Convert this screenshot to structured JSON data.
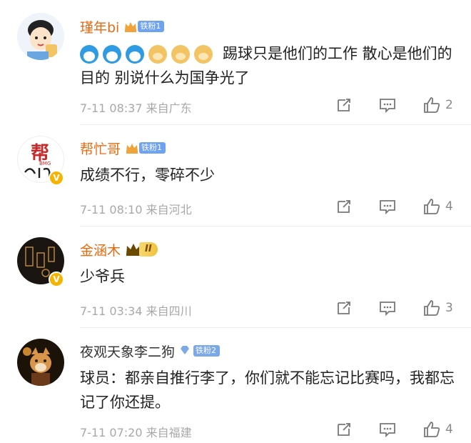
{
  "comments": [
    {
      "username": "瑾年bi",
      "fan_badge": "铁粉1",
      "text": "踢球只是他们的工作  散心是他们的目的 别说什么为国争光了",
      "emojis": [
        "doraemon",
        "doraemon",
        "doraemon",
        "doge",
        "doge",
        "doge"
      ],
      "meta": "7-11 08:37  来自广东",
      "likes": "2",
      "avatar_icon": "cartoon-avatar-icon"
    },
    {
      "username": "帮忙哥",
      "fan_badge": "铁粉1",
      "text": "成绩不行，零碎不少",
      "meta": "7-11 08:10  来自河北",
      "likes": "4",
      "avatar_icon": "bmg-logo-avatar-icon"
    },
    {
      "username": "金涵木",
      "vip_badge": "II",
      "text": "少爷兵",
      "meta": "7-11 03:34  来自四川",
      "likes": "3",
      "avatar_icon": "dark-pattern-avatar-icon"
    },
    {
      "username": "夜观天象李二狗",
      "fan_badge": "铁粉2",
      "text": "球员：都亲自推行李了，你们就不能忘记比赛吗，我都忘记了你还提。",
      "meta": "7-11 07:20  来自福建",
      "likes": "4",
      "avatar_icon": "dog-avatar-icon"
    }
  ],
  "colors": {
    "username_orange": "#e86a10",
    "meta_gray": "#a8a8a8",
    "badge_blue": "#6fa3ef",
    "verified_yellow": "#f5b400"
  }
}
